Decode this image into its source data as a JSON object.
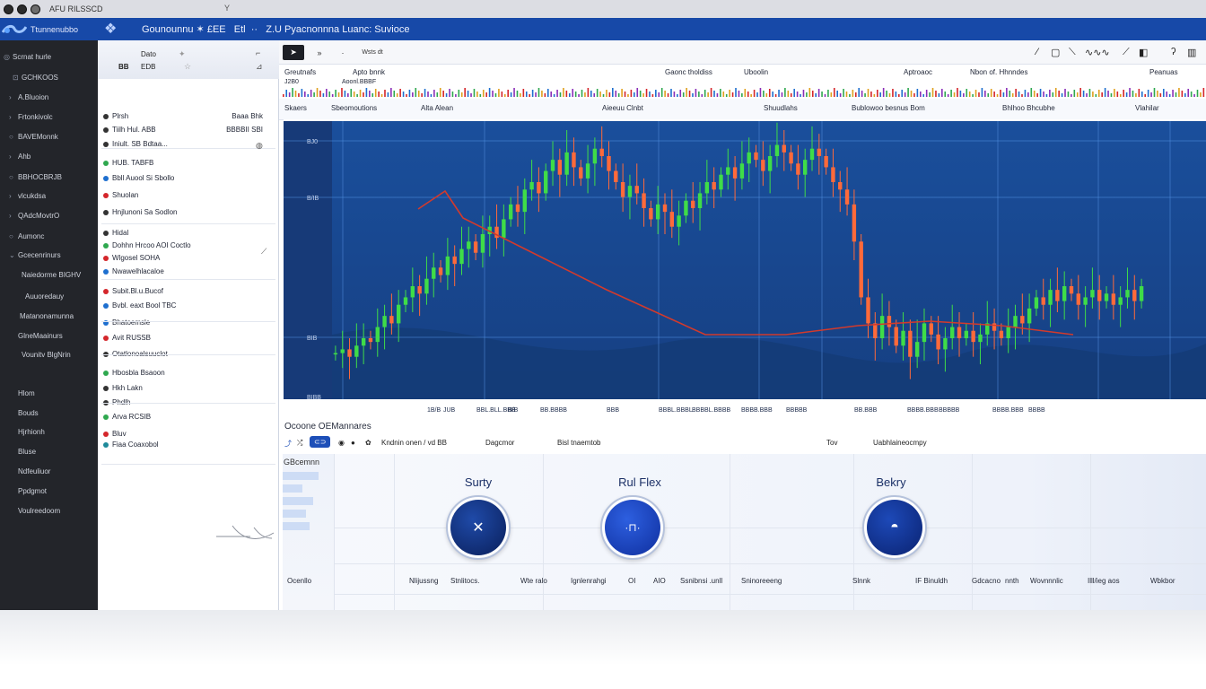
{
  "os": {
    "title": "AFU RILSSCD",
    "extra": "Y"
  },
  "app": {
    "name": "Ttunnenubbo",
    "window_title": "Gounounnu ✶ £EE   Etl  ··   Z.U Pyacnonnna Luanc: Suvioce"
  },
  "leftnav": {
    "items": [
      "Scrnat hurle",
      "GCHKOOS",
      "A.Bluoion",
      "Frtonkivolc",
      "BAVEMonnk",
      "Ahb",
      "BBHOCBRJB",
      "vlcukdsa",
      "QAdcMovtrO",
      "Aumonc",
      "Gcecenrinurs",
      "Naiedorme BIGHV",
      "Auuoredauy",
      "Matanonamunna",
      "GlneMaainurs",
      "Vounitv BlgNrin",
      "Hlom",
      "Bouds",
      "Hjrhionh",
      "Bluse",
      "Ndfeuliuor",
      "Ppdgmot",
      "Voulreedoom"
    ]
  },
  "sidepanel": {
    "header": {
      "top": "Dato",
      "num1": "BB",
      "num2": "EDB"
    },
    "rows": [
      {
        "label": "Plrsh",
        "right": "Baaa Bhk",
        "color": "#333333"
      },
      {
        "label": "Tiilh Hul. ABB",
        "right": "BBBBII SBI",
        "color": "#333333"
      },
      {
        "label": "Iniult. SB Bdtaa...",
        "right": "",
        "color": "#333333"
      },
      {
        "label": "HUB. TABFB",
        "right": "",
        "color": "#2fa84f"
      },
      {
        "label": "Bbll Auool Si Sbollo",
        "right": "",
        "color": "#1e6fcf"
      },
      {
        "label": "Shuolan",
        "right": "",
        "color": "#d4262b"
      },
      {
        "label": "Hnjlunoni Sa Sodlon",
        "right": "",
        "color": "#333333"
      },
      {
        "label": "Hidal",
        "right": "",
        "color": "#333333"
      },
      {
        "label": "Dohhn Hrcoo AOI Coctlo",
        "right": "",
        "color": "#2fa84f"
      },
      {
        "label": "Wlgosel SOHA",
        "right": "",
        "color": "#d4262b"
      },
      {
        "label": "Nwawelhlacaloe",
        "right": "",
        "color": "#1e6fcf"
      },
      {
        "label": "Subit.Bl.u.Bucof",
        "right": "",
        "color": "#d4262b"
      },
      {
        "label": "Bvbl. eaxt Bool TBC",
        "right": "",
        "color": "#1e6fcf"
      },
      {
        "label": "Bhatoemsle",
        "right": "",
        "color": "#1e6fcf"
      },
      {
        "label": "Avit RUSSB",
        "right": "",
        "color": "#d4262b"
      },
      {
        "label": "Otatlonoalsuuclot",
        "right": "",
        "color": "#333333"
      },
      {
        "label": "Hbosbla Bsaoon",
        "right": "",
        "color": "#2fa84f"
      },
      {
        "label": "Hkh Lakn",
        "right": "",
        "color": "#333333"
      },
      {
        "label": "Phdlh",
        "right": "",
        "color": "#333333"
      },
      {
        "label": "Arva RCSIB",
        "right": "",
        "color": "#2fa84f"
      },
      {
        "label": "Bluv",
        "right": "",
        "color": "#d4262b"
      },
      {
        "label": "Fiaa Coaxobol",
        "right": "",
        "color": "#1e8a9a"
      }
    ]
  },
  "toolbar": {
    "items": [
      "»",
      "·",
      "Wsts dt"
    ]
  },
  "info_row1": {
    "labels": [
      "Greutnafs",
      "Apto bnnk",
      "Gaonc tholdiss",
      "Uboolin",
      "Aptroaoc",
      "Nbon of. Hhnndes",
      "Peanuas"
    ],
    "sub": [
      "J2B0",
      "Aoonl.BBBF"
    ]
  },
  "info_row2": {
    "labels": [
      "Skaers",
      "Sbeomoutions",
      "Alta Alean",
      "Aieeuu Clnbt",
      "Shuudlahs",
      "Bublowoo besnus Bom",
      "Bhlhoo Bhcubhe",
      "Vlahilar"
    ]
  },
  "chart_data": {
    "type": "candlestick",
    "y_ticks": [
      "BJ0",
      "B/IB",
      "BIB",
      "BIBB"
    ],
    "x_ticks": [
      "1B/B",
      "JUB",
      "B/B",
      "BBL.BLL.BBB",
      "BB.BBBB",
      "BBB",
      "BBBL.BBBL",
      "BBBBL.BBBB",
      "BBBB.BBB",
      "BBBBB",
      "BB.BBB",
      "BBBB.BBB",
      "BBBBB",
      "BBBB.BBB",
      "BBBB"
    ],
    "series": [
      {
        "name": "",
        "color": "#d23a2c"
      }
    ],
    "ohlc_close": [
      40,
      41,
      39,
      42,
      44,
      43,
      47,
      50,
      48,
      53,
      55,
      58,
      56,
      60,
      63,
      61,
      66,
      64,
      68,
      70,
      67,
      72,
      74,
      71,
      76,
      80,
      78,
      84,
      86,
      83,
      89,
      92,
      88,
      94,
      90,
      87,
      91,
      95,
      93,
      89,
      86,
      82,
      85,
      83,
      79,
      76,
      80,
      78,
      74,
      77,
      81,
      79,
      83,
      86,
      84,
      88,
      90,
      87,
      91,
      94,
      92,
      89,
      93,
      96,
      94,
      91,
      88,
      92,
      95,
      93,
      90,
      86,
      84,
      80,
      70,
      55,
      48,
      44,
      50,
      47,
      42,
      46,
      39,
      43,
      48,
      45,
      41,
      44,
      47,
      44,
      46,
      43,
      45,
      48,
      46,
      44,
      47,
      50,
      48,
      52,
      55,
      53,
      57,
      54,
      58,
      56,
      53,
      55,
      57,
      54,
      56,
      53,
      55,
      57,
      54,
      58
    ]
  },
  "bottom_panel": {
    "title": "Ocoone OEMannares",
    "toolbar": [
      "Kndnin onen / vd BB",
      "Dagcmor",
      "Bisl tnaemtob",
      "Tov",
      "Uabhlaineocmpy"
    ],
    "left_head": "GBcemnn",
    "cards": [
      {
        "label": "Surty",
        "icon": "close-x"
      },
      {
        "label": "Rul Flex",
        "icon": "meter"
      },
      {
        "label": "Bekry",
        "icon": "helmet"
      }
    ],
    "footer": [
      "Ocenllo",
      "Nlijussng",
      "Stnlitocs.",
      "Wte ralo",
      "Ignlenrahgi",
      "OI",
      "AIO",
      "Ssnibnsi .unll",
      "Sninoreeeng",
      "Slnnk",
      "IF Binuldh",
      "Gdcacno",
      "nnth",
      "Wovnnnlic",
      "Illl/ieg aos",
      "Wbkbor"
    ]
  }
}
